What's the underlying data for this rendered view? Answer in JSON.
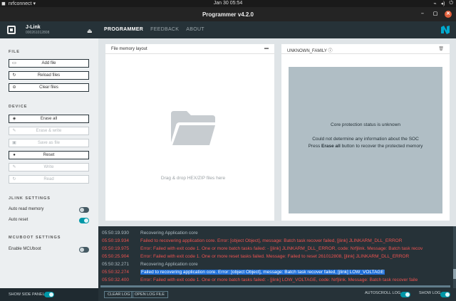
{
  "os": {
    "app_name": "nrfconnect",
    "clock": "Jan 30  05:54"
  },
  "window": {
    "title": "Programmer v4.2.0"
  },
  "device": {
    "name": "J-Link",
    "serial": "000261012808"
  },
  "nav": {
    "tabs": [
      "PROGRAMMER",
      "FEEDBACK",
      "ABOUT"
    ],
    "active": "PROGRAMMER"
  },
  "sidebar": {
    "file_title": "FILE",
    "file_buttons": [
      "Add file",
      "Reload files",
      "Clear files"
    ],
    "device_title": "DEVICE",
    "device_buttons": [
      "Erase all",
      "Erase & write",
      "Save as file",
      "Reset",
      "Write",
      "Read"
    ],
    "jlink_title": "JLINK SETTINGS",
    "auto_read_label": "Auto read memory",
    "auto_read_on": false,
    "auto_reset_label": "Auto reset",
    "auto_reset_on": true,
    "mcuboot_title": "MCUBOOT SETTINGS",
    "enable_mcuboot_label": "Enable MCUboot",
    "enable_mcuboot_on": false
  },
  "file_memory": {
    "title": "File memory layout",
    "drop_text": "Drag & drop HEX/ZIP files here"
  },
  "unknown": {
    "title": "UNKNOWN_FAMILY",
    "status": "Core protection status is unknown",
    "line1": "Could not determine any information about the SOC",
    "line2_pre": "Press ",
    "line2_bold": "Erase all",
    "line2_post": " button to recover the protected memory"
  },
  "log": {
    "lines": [
      {
        "ts": "05:50:19.930",
        "msg": "Recovering Application core",
        "level": "info"
      },
      {
        "ts": "05:50:19.934",
        "msg": "Failed to recovering application core. Error: [object Object], message: Batch task recover failed, [jlink] JLINKARM_DLL_ERROR",
        "level": "error"
      },
      {
        "ts": "05:50:19.975",
        "msg": "Error: Failed with exit code 1. One or more batch tasks failed: - [jlink] JLINKARM_DLL_ERROR, code: Nrfjlink. Message: Batch task recov",
        "level": "error"
      },
      {
        "ts": "05:50:25.904",
        "msg": "Error: Failed with exit code 1. One or more reset tasks failed. Message: Failed to reset 261012808, [jlink] JLINKARM_DLL_ERROR",
        "level": "error"
      },
      {
        "ts": "05:50:32.271",
        "msg": "Recovering Application core",
        "level": "info"
      },
      {
        "ts": "05:50:32.274",
        "msg": "Failed to recovering application core. Error: [object Object], message: Batch task recover failed, [jlink] LOW_VOLTAGE",
        "level": "selected"
      },
      {
        "ts": "05:50:32.400",
        "msg": "Error: Failed with exit code 1. One or more batch tasks failed: - [jlink] LOW_VOLTAGE, code: Nrfjlink. Message: Batch task recover faile",
        "level": "error"
      }
    ]
  },
  "bottom": {
    "show_side_panel": "SHOW SIDE PANEL",
    "clear_log": "CLEAR LOG",
    "open_log_file": "OPEN LOG FILE",
    "autoscroll_log": "AUTOSCROLL LOG",
    "show_log": "SHOW LOG"
  },
  "colors": {
    "header_bg": "#263238",
    "accent": "#0097a7",
    "error": "#ef5350"
  }
}
